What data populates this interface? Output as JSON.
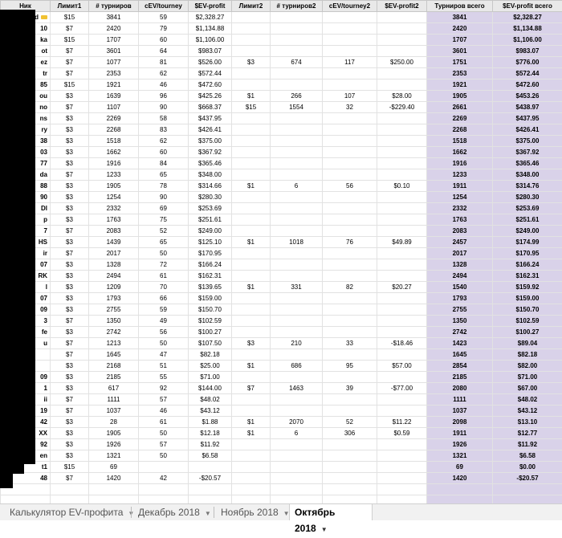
{
  "sheet": {
    "headers": [
      "Ник",
      "Лимит1",
      "# турниров",
      "cEV/tourney",
      "$EV-profit",
      "Лимит2",
      "# турниров2",
      "cEV/tourney2",
      "$EV-profit2",
      "Турниров всего",
      "$EV-profit всего"
    ],
    "rows": [
      [
        "d",
        "$15",
        "3841",
        "59",
        "$2,328.27",
        "",
        "",
        "",
        "",
        "3841",
        "$2,328.27"
      ],
      [
        "10",
        "$7",
        "2420",
        "79",
        "$1,134.88",
        "",
        "",
        "",
        "",
        "2420",
        "$1,134.88"
      ],
      [
        "ka",
        "$15",
        "1707",
        "60",
        "$1,106.00",
        "",
        "",
        "",
        "",
        "1707",
        "$1,106.00"
      ],
      [
        "ot",
        "$7",
        "3601",
        "64",
        "$983.07",
        "",
        "",
        "",
        "",
        "3601",
        "$983.07"
      ],
      [
        "ez",
        "$7",
        "1077",
        "81",
        "$526.00",
        "$3",
        "674",
        "117",
        "$250.00",
        "1751",
        "$776.00"
      ],
      [
        "tr",
        "$7",
        "2353",
        "62",
        "$572.44",
        "",
        "",
        "",
        "",
        "2353",
        "$572.44"
      ],
      [
        "85",
        "$15",
        "1921",
        "46",
        "$472.60",
        "",
        "",
        "",
        "",
        "1921",
        "$472.60"
      ],
      [
        "ou",
        "$3",
        "1639",
        "96",
        "$425.26",
        "$1",
        "266",
        "107",
        "$28.00",
        "1905",
        "$453.26"
      ],
      [
        "no",
        "$7",
        "1107",
        "90",
        "$668.37",
        "$15",
        "1554",
        "32",
        "-$229.40",
        "2661",
        "$438.97"
      ],
      [
        "ns",
        "$3",
        "2269",
        "58",
        "$437.95",
        "",
        "",
        "",
        "",
        "2269",
        "$437.95"
      ],
      [
        "ry",
        "$3",
        "2268",
        "83",
        "$426.41",
        "",
        "",
        "",
        "",
        "2268",
        "$426.41"
      ],
      [
        "38",
        "$3",
        "1518",
        "62",
        "$375.00",
        "",
        "",
        "",
        "",
        "1518",
        "$375.00"
      ],
      [
        "03",
        "$3",
        "1662",
        "60",
        "$367.92",
        "",
        "",
        "",
        "",
        "1662",
        "$367.92"
      ],
      [
        "77",
        "$3",
        "1916",
        "84",
        "$365.46",
        "",
        "",
        "",
        "",
        "1916",
        "$365.46"
      ],
      [
        "da",
        "$7",
        "1233",
        "65",
        "$348.00",
        "",
        "",
        "",
        "",
        "1233",
        "$348.00"
      ],
      [
        "88",
        "$3",
        "1905",
        "78",
        "$314.66",
        "$1",
        "6",
        "56",
        "$0.10",
        "1911",
        "$314.76"
      ],
      [
        "90",
        "$3",
        "1254",
        "90",
        "$280.30",
        "",
        "",
        "",
        "",
        "1254",
        "$280.30"
      ],
      [
        "Dl",
        "$3",
        "2332",
        "69",
        "$253.69",
        "",
        "",
        "",
        "",
        "2332",
        "$253.69"
      ],
      [
        "p",
        "$3",
        "1763",
        "75",
        "$251.61",
        "",
        "",
        "",
        "",
        "1763",
        "$251.61"
      ],
      [
        "7",
        "$7",
        "2083",
        "52",
        "$249.00",
        "",
        "",
        "",
        "",
        "2083",
        "$249.00"
      ],
      [
        "HS",
        "$3",
        "1439",
        "65",
        "$125.10",
        "$1",
        "1018",
        "76",
        "$49.89",
        "2457",
        "$174.99"
      ],
      [
        "ir",
        "$7",
        "2017",
        "50",
        "$170.95",
        "",
        "",
        "",
        "",
        "2017",
        "$170.95"
      ],
      [
        "07",
        "$3",
        "1328",
        "72",
        "$166.24",
        "",
        "",
        "",
        "",
        "1328",
        "$166.24"
      ],
      [
        "RK",
        "$3",
        "2494",
        "61",
        "$162.31",
        "",
        "",
        "",
        "",
        "2494",
        "$162.31"
      ],
      [
        "l",
        "$3",
        "1209",
        "70",
        "$139.65",
        "$1",
        "331",
        "82",
        "$20.27",
        "1540",
        "$159.92"
      ],
      [
        "07",
        "$3",
        "1793",
        "66",
        "$159.00",
        "",
        "",
        "",
        "",
        "1793",
        "$159.00"
      ],
      [
        "09",
        "$3",
        "2755",
        "59",
        "$150.70",
        "",
        "",
        "",
        "",
        "2755",
        "$150.70"
      ],
      [
        "3",
        "$7",
        "1350",
        "49",
        "$102.59",
        "",
        "",
        "",
        "",
        "1350",
        "$102.59"
      ],
      [
        "fe",
        "$3",
        "2742",
        "56",
        "$100.27",
        "",
        "",
        "",
        "",
        "2742",
        "$100.27"
      ],
      [
        "u",
        "$7",
        "1213",
        "50",
        "$107.50",
        "$3",
        "210",
        "33",
        "-$18.46",
        "1423",
        "$89.04"
      ],
      [
        "",
        "$7",
        "1645",
        "47",
        "$82.18",
        "",
        "",
        "",
        "",
        "1645",
        "$82.18"
      ],
      [
        "",
        "$3",
        "2168",
        "51",
        "$25.00",
        "$1",
        "686",
        "95",
        "$57.00",
        "2854",
        "$82.00"
      ],
      [
        "09",
        "$3",
        "2185",
        "55",
        "$71.00",
        "",
        "",
        "",
        "",
        "2185",
        "$71.00"
      ],
      [
        "1",
        "$3",
        "617",
        "92",
        "$144.00",
        "$7",
        "1463",
        "39",
        "-$77.00",
        "2080",
        "$67.00"
      ],
      [
        "ii",
        "$7",
        "1111",
        "57",
        "$48.02",
        "",
        "",
        "",
        "",
        "1111",
        "$48.02"
      ],
      [
        "19",
        "$7",
        "1037",
        "46",
        "$43.12",
        "",
        "",
        "",
        "",
        "1037",
        "$43.12"
      ],
      [
        "42",
        "$3",
        "28",
        "61",
        "$1.88",
        "$1",
        "2070",
        "52",
        "$11.22",
        "2098",
        "$13.10"
      ],
      [
        "XX",
        "$3",
        "1905",
        "50",
        "$12.18",
        "$1",
        "6",
        "306",
        "$0.59",
        "1911",
        "$12.77"
      ],
      [
        "92",
        "$3",
        "1926",
        "57",
        "$11.92",
        "",
        "",
        "",
        "",
        "1926",
        "$11.92"
      ],
      [
        "en",
        "$3",
        "1321",
        "50",
        "$6.58",
        "",
        "",
        "",
        "",
        "1321",
        "$6.58"
      ],
      [
        "t1",
        "$15",
        "69",
        "",
        "",
        "",
        "",
        "",
        "",
        "69",
        "$0.00"
      ],
      [
        "48",
        "$7",
        "1420",
        "42",
        "-$20.57",
        "",
        "",
        "",
        "",
        "1420",
        "-$20.57"
      ]
    ]
  },
  "tabs": [
    {
      "label": "Калькулятор EV-профита",
      "active": false
    },
    {
      "label": "Декабрь 2018",
      "active": false
    },
    {
      "label": "Ноябрь 2018",
      "active": false
    },
    {
      "label": "Октябрь 2018",
      "active": true
    }
  ],
  "icons": {
    "tab_dropdown": "chevron-down-icon",
    "flag": "flag-icon"
  },
  "colors": {
    "header_bg": "#e9e9e9",
    "totals_bg": "#d9d2e9",
    "accent_border": "#0f9d58",
    "redaction": "#000000",
    "flag": "#f1c232"
  }
}
